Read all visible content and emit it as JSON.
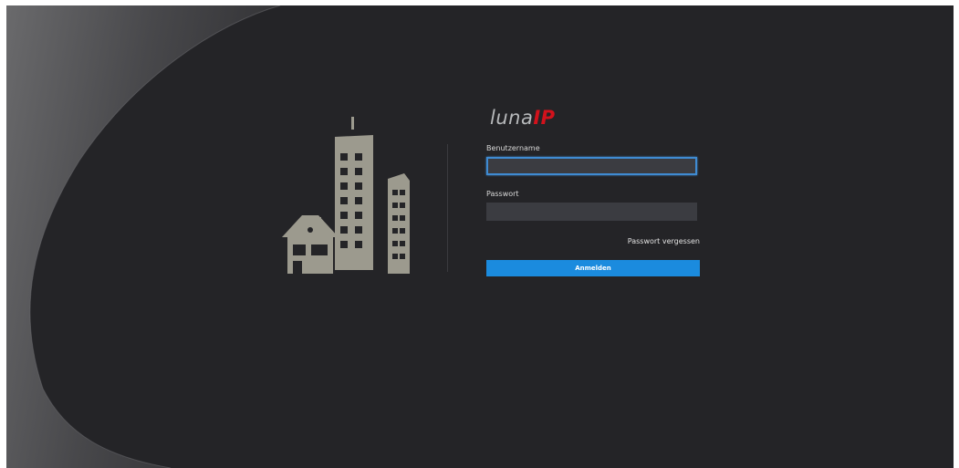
{
  "brand": {
    "logo_part1": "luna",
    "logo_part2": "IP",
    "logo_part1_color": "#b7b9bb",
    "logo_part2_color": "#d2121c"
  },
  "login_form": {
    "username_label": "Benutzername",
    "username_value": "",
    "password_label": "Passwort",
    "password_value": "",
    "forgot_password": "Passwort vergessen",
    "login_button": "Anmelden"
  },
  "theme": {
    "background": "#242427",
    "accent": "#1b8bde",
    "focus_border": "#3f8bd2",
    "illustration_color": "#9c9a8e"
  },
  "illustration": {
    "icon": "city-buildings-icon"
  }
}
